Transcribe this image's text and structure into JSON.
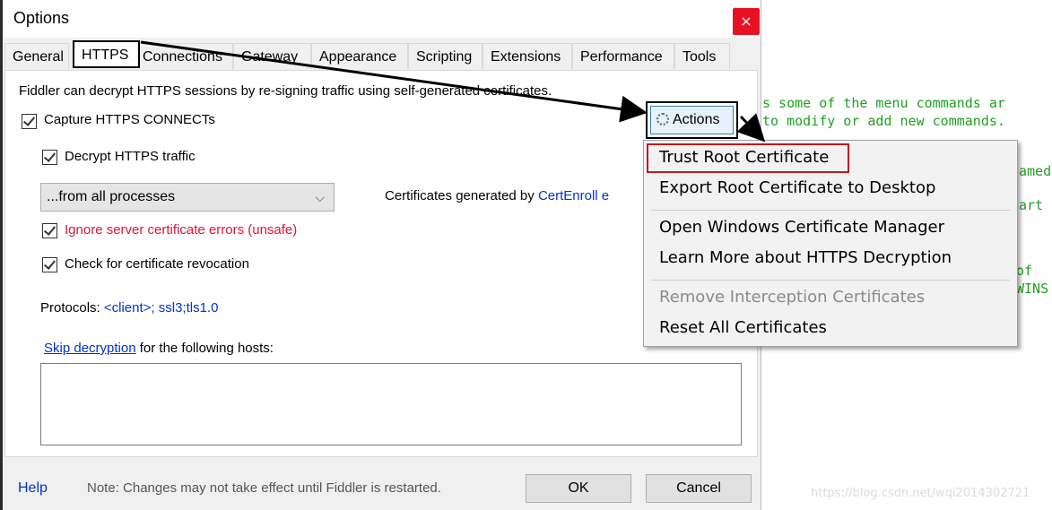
{
  "window": {
    "title": "Options",
    "close_label": "×"
  },
  "tabs": [
    "General",
    "HTTPS",
    "Connections",
    "Gateway",
    "Appearance",
    "Scripting",
    "Extensions",
    "Performance",
    "Tools"
  ],
  "https": {
    "intro": "Fiddler can decrypt HTTPS sessions by re-signing traffic using self-generated certificates.",
    "capture_label": "Capture HTTPS CONNECTs",
    "decrypt_label": "Decrypt HTTPS traffic",
    "process_select": "...from all processes",
    "certs_prefix": "Certificates generated by ",
    "certs_engine": "CertEnroll e",
    "ignore_label": "Ignore server certificate errors (unsafe)",
    "revocation_label": "Check for certificate revocation",
    "protocols_label": "Protocols: ",
    "protocols_value": "<client>; ssl3;tls1.0",
    "skip_link": "Skip decryption",
    "skip_rest": " for the following hosts:",
    "actions_label": "Actions"
  },
  "menu": {
    "items": [
      "Trust Root Certificate",
      "Export Root Certificate to Desktop",
      "Open Windows Certificate Manager",
      "Learn More about HTTPS Decryption",
      "Remove Interception Certificates",
      "Reset All Certificates"
    ]
  },
  "footer": {
    "help": "Help",
    "note": "Note: Changes may not take effect until Fiddler is restarted.",
    "ok": "OK",
    "cancel": "Cancel"
  },
  "background_code": [
    "s some of the menu commands ar",
    "to modify or add new commands.",
    "amed",
    "art",
    "of",
    "WINS"
  ],
  "watermark": "https://blog.csdn.net/wqi2014302721",
  "colors": {
    "close": "#e81123",
    "highlight_box": "#c0181f",
    "link": "#0033cc",
    "warning": "#e0143c",
    "code": "#21a021"
  }
}
